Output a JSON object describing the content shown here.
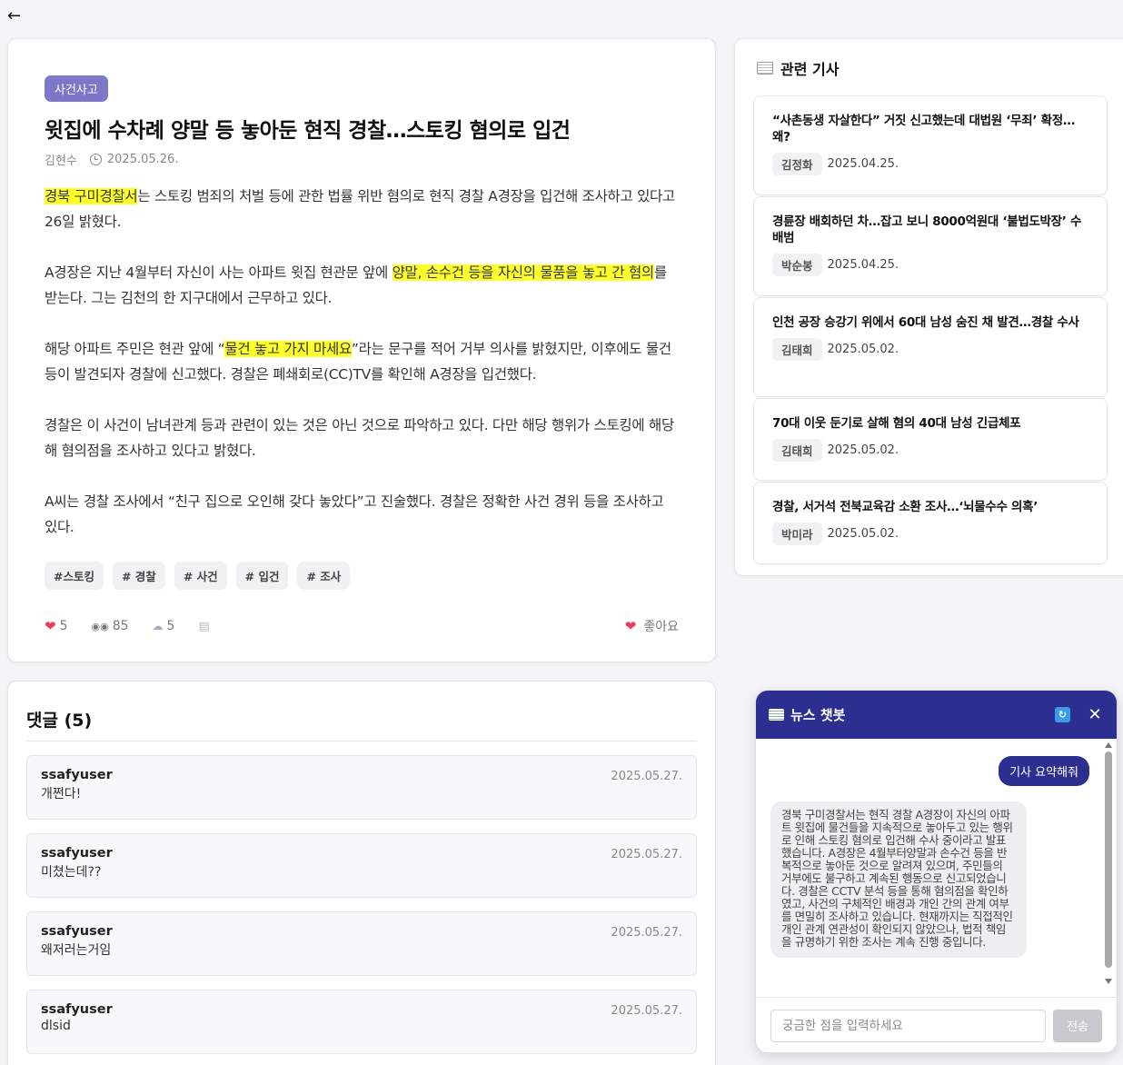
{
  "nav": {
    "back_icon": "arrow-left-icon"
  },
  "article": {
    "category": "사건사고",
    "title": "윗집에 수차례 양말 등 놓아둔 현직 경찰…스토킹 혐의로 입건",
    "author": "김현수",
    "date": "2025.05.26.",
    "p1_hl": "경북 구미경찰서",
    "p1_rest": "는 스토킹 범죄의 처벌 등에 관한 법률 위반 혐의로 현직 경찰 A경장을 입건해 조사하고 있다고 26일 밝혔다.",
    "p2_pre": "A경장은 지난 4월부터 자신이 사는 아파트 윗집 현관문 앞에 ",
    "p2_hl": "양말, 손수건 등을 자신의 물품을 놓고 간 혐의",
    "p2_post": "를 받는다. 그는 김천의 한 지구대에서 근무하고 있다.",
    "p3_pre": "해당 아파트 주민은 현관 앞에 “",
    "p3_hl": "물건 놓고 가지 마세요",
    "p3_post": "”라는 문구를 적어 거부 의사를 밝혔지만, 이후에도 물건 등이 발견되자 경찰에 신고했다. 경찰은 폐쇄회로(CC)TV를 확인해 A경장을 입건했다.",
    "p4": "경찰은 이 사건이 남녀관계 등과 관련이 있는 것은 아닌 것으로 파악하고 있다. 다만 해당 행위가 스토킹에 해당해 혐의점을 조사하고 있다고 밝혔다.",
    "p5": "A씨는 경찰 조사에서 “친구 집으로 오인해 갖다 놓았다”고 진술했다. 경찰은 정확한 사건 경위 등을 조사하고 있다.",
    "tags": [
      "#스토킹",
      "# 경찰",
      "# 사건",
      "# 입건",
      "# 조사"
    ],
    "likes": "5",
    "views": "85",
    "comment_count": "5",
    "like_label": "좋아요",
    "highlight_color": "#ffff2a",
    "category_color": "#7c77c6"
  },
  "comments": {
    "title": "댓글 (5)",
    "items": [
      {
        "user": "ssafyuser",
        "text": "개쩐다!",
        "date": "2025.05.27."
      },
      {
        "user": "ssafyuser",
        "text": "미쳤는데??",
        "date": "2025.05.27."
      },
      {
        "user": "ssafyuser",
        "text": "왜저러는거임",
        "date": "2025.05.27."
      },
      {
        "user": "ssafyuser",
        "text": "dlsid",
        "date": "2025.05.27."
      }
    ]
  },
  "related": {
    "title": "관련 기사",
    "items": [
      {
        "title": "“사촌동생 자살한다” 거짓 신고했는데 대법원 ‘무죄’ 확정… 왜?",
        "author": "김정화",
        "date": "2025.04.25."
      },
      {
        "title": "경륜장 배회하던 차…잡고 보니 8000억원대 ‘불법도박장’ 수배범",
        "author": "박순봉",
        "date": "2025.04.25."
      },
      {
        "title": "인천 공장 승강기 위에서 60대 남성 숨진 채 발견…경찰 수사",
        "author": "김태희",
        "date": "2025.05.02."
      },
      {
        "title": "70대 이웃 둔기로 살해 혐의 40대 남성 긴급체포",
        "author": "김태희",
        "date": "2025.05.02."
      },
      {
        "title": "경찰, 서거석 전북교육감 소환 조사…‘뇌물수수 의혹’",
        "author": "박미라",
        "date": "2025.05.02."
      }
    ]
  },
  "chatbot": {
    "title": "뉴스 챗봇",
    "user_message": "기사 요약해줘",
    "bot_message": "경북 구미경찰서는 현직 경찰 A경장이 자신의 아파트 윗집에 물건들을 지속적으로 놓아두고 있는 행위로 인해 스토킹 혐의로 입건해 수사 중이라고 발표했습니다. A경장은 4월부터양말과 손수건 등을 반복적으로 놓아둔 것으로 알려져 있으며, 주민들의 거부에도 불구하고 계속된 행동으로 신고되었습니다. 경찰은 CCTV 분석 등을 통해 혐의점을 확인하였고, 사건의 구체적인 배경과 개인 간의 관계 여부를 면밀히 조사하고 있습니다. 현재까지는 직접적인 개인 관계 연관성이 확인되지 않았으나, 법적 책임을 규명하기 위한 조사는 계속 진행 중입니다.",
    "input_placeholder": "궁금한 점을 입력하세요",
    "send_label": "전송",
    "header_color": "#2c2f8f"
  }
}
